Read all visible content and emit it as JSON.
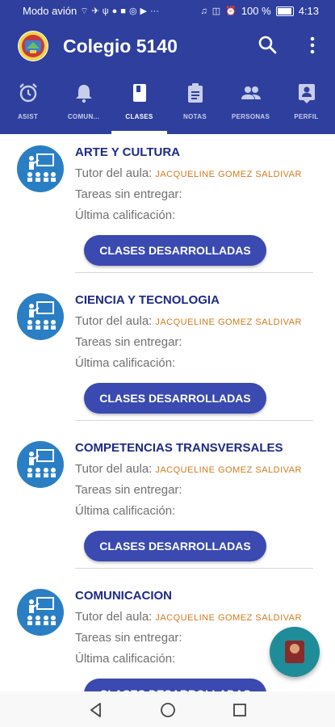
{
  "status_bar": {
    "left_text": "Modo avión",
    "battery": "100 %",
    "time": "4:13"
  },
  "app": {
    "title": "Colegio 5140"
  },
  "tabs": [
    {
      "label": "ASIST",
      "icon": "alarm-clock-icon"
    },
    {
      "label": "COMUN...",
      "icon": "bell-icon"
    },
    {
      "label": "CLASES",
      "icon": "book-icon",
      "active": true
    },
    {
      "label": "NOTAS",
      "icon": "clipboard-icon"
    },
    {
      "label": "PERSONAS",
      "icon": "people-icon"
    },
    {
      "label": "PERFIL",
      "icon": "profile-card-icon"
    }
  ],
  "classes": [
    {
      "subject": "ARTE Y CULTURA",
      "tutor_label": "Tutor del aula:",
      "tutor_name": "JACQUELINE GOMEZ SALDIVAR",
      "pending_label": "Tareas sin entregar:",
      "last_grade_label": "Última calificación:",
      "button_label": "CLASES DESARROLLADAS"
    },
    {
      "subject": "CIENCIA Y TECNOLOGIA",
      "tutor_label": "Tutor del aula:",
      "tutor_name": "JACQUELINE GOMEZ SALDIVAR",
      "pending_label": "Tareas sin entregar:",
      "last_grade_label": "Última calificación:",
      "button_label": "CLASES DESARROLLADAS"
    },
    {
      "subject": "COMPETENCIAS TRANSVERSALES",
      "tutor_label": "Tutor del aula:",
      "tutor_name": "JACQUELINE GOMEZ SALDIVAR",
      "pending_label": "Tareas sin entregar:",
      "last_grade_label": "Última calificación:",
      "button_label": "CLASES DESARROLLADAS"
    },
    {
      "subject": "COMUNICACION",
      "tutor_label": "Tutor del aula:",
      "tutor_name": "JACQUELINE GOMEZ SALDIVAR",
      "pending_label": "Tareas sin entregar:",
      "last_grade_label": "Última calificación:",
      "button_label": "CLASES DESARROLLADAS"
    }
  ],
  "colors": {
    "primary": "#2e3f9e",
    "button": "#3a4ab0",
    "subject_text": "#1c2a86",
    "tutor_name": "#d4791a",
    "avatar": "#2a7fc4",
    "fab": "#1f8c9a"
  }
}
